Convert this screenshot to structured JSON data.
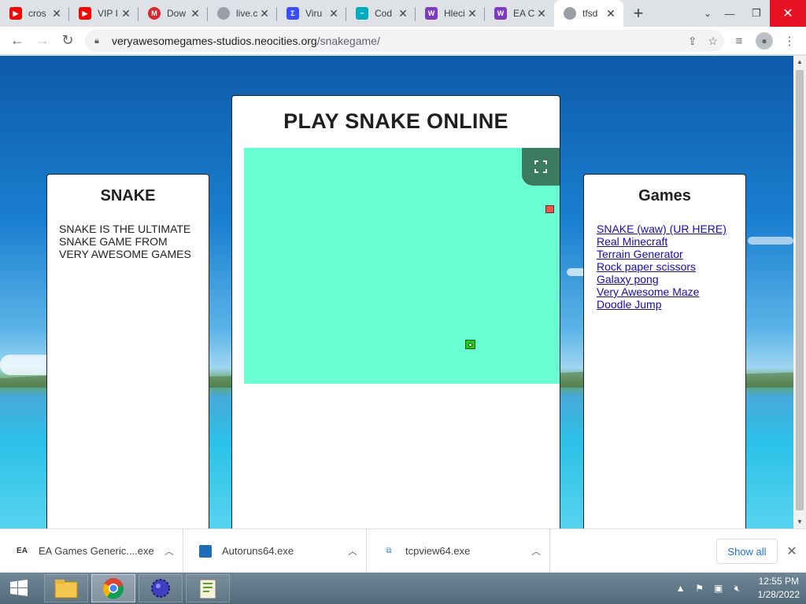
{
  "browser": {
    "tabs": [
      {
        "title": "cros",
        "icon": "youtube-icon",
        "color": "#ff0000"
      },
      {
        "title": "VIP I",
        "icon": "youtube-icon",
        "color": "#ff0000"
      },
      {
        "title": "Dow",
        "icon": "mega-icon",
        "color": "#d9272e"
      },
      {
        "title": "live.c",
        "icon": "globe-icon",
        "color": "#5f6368"
      },
      {
        "title": "Viru",
        "icon": "virustotal-icon",
        "color": "#394eff"
      },
      {
        "title": "Cod",
        "icon": "codeorg-icon",
        "color": "#00adbc"
      },
      {
        "title": "Hleci",
        "icon": "twitch-icon",
        "color": "#7e3bbf"
      },
      {
        "title": "EA C",
        "icon": "twitch-icon",
        "color": "#7e3bbf"
      },
      {
        "title": "tfsd",
        "icon": "globe-icon",
        "color": "#5f6368"
      }
    ],
    "url_domain": "veryawesomegames-studios.neocities.org",
    "url_path": "/snakegame/"
  },
  "page": {
    "main_title": "PLAY SNAKE ONLINE",
    "left": {
      "heading": "SNAKE",
      "description": "SNAKE IS THE ULTIMATE SNAKE GAME FROM VERY AWESOME GAMES"
    },
    "right": {
      "heading": "Games",
      "links": [
        "SNAKE (waw) (UR HERE)",
        "Real Minecraft",
        "Terrain Generator",
        "Rock paper scissors",
        "Galaxy pong",
        "Very Awesome Maze",
        "Doodle Jump"
      ]
    },
    "game": {
      "background": "#6affd2",
      "fullscreen_button_color": "#3a7a5e",
      "food_color": "#ef5350",
      "snake_color": "#23c523"
    }
  },
  "downloads": {
    "items": [
      {
        "name": "EA Games Generic....exe"
      },
      {
        "name": "Autoruns64.exe"
      },
      {
        "name": "tcpview64.exe"
      }
    ],
    "show_all_label": "Show all"
  },
  "taskbar": {
    "time": "12:55 PM",
    "date": "1/28/2022"
  }
}
